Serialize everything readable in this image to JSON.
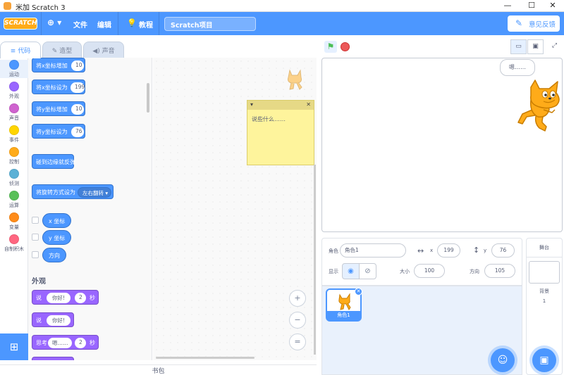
{
  "window": {
    "title": "米加 Scratch 3",
    "min": "—",
    "max": "☐",
    "close": "✕"
  },
  "menu": {
    "logo": "SCRATCH",
    "globe": "⊕ ▾",
    "file": "文件",
    "edit": "编辑",
    "tutorials": "教程",
    "project_title": "Scratch项目",
    "feedback": "意见反馈"
  },
  "tabs": {
    "code": "代码",
    "costumes": "造型",
    "sounds": "声音"
  },
  "categories": [
    {
      "label": "运动",
      "color": "#4c97ff"
    },
    {
      "label": "外观",
      "color": "#9966ff"
    },
    {
      "label": "声音",
      "color": "#cf63cf"
    },
    {
      "label": "事件",
      "color": "#ffd500"
    },
    {
      "label": "控制",
      "color": "#ffab19"
    },
    {
      "label": "侦测",
      "color": "#5cb1d6"
    },
    {
      "label": "运算",
      "color": "#59c059"
    },
    {
      "label": "变量",
      "color": "#ff8c1a"
    },
    {
      "label": "自制积木",
      "color": "#ff6680"
    }
  ],
  "blocks": {
    "change_x": "将x坐标增加",
    "change_x_val": "10",
    "set_x": "将x坐标设为",
    "set_x_val": "199",
    "change_y": "将y坐标增加",
    "change_y_val": "10",
    "set_y": "将y坐标设为",
    "set_y_val": "76",
    "bounce": "碰到边缘就反弹",
    "rotation": "将旋转方式设为",
    "rotation_val": "左右翻转 ▾",
    "x_pos": "x 坐标",
    "y_pos": "y 坐标",
    "direction": "方向",
    "looks_header": "外观",
    "say_secs": "说",
    "say_secs_text": "你好!",
    "say_secs_num": "2",
    "say_secs_unit": "秒",
    "say": "说",
    "say_text": "你好!",
    "think_secs": "思考",
    "think_text": "嗯……",
    "think_num": "2",
    "think_unit": "秒"
  },
  "note": {
    "collapse": "▾",
    "close": "✕",
    "text": "说些什么……"
  },
  "zoom": {
    "in": "+",
    "out": "−",
    "reset": "="
  },
  "backpack": "书包",
  "stage": {
    "bubble": "嗯……"
  },
  "sprite_info": {
    "sprite_label": "角色",
    "sprite_name": "角色1",
    "x_label": "x",
    "x_val": "199",
    "y_label": "y",
    "y_val": "76",
    "show_label": "显示",
    "size_label": "大小",
    "size_val": "100",
    "direction_label": "方向",
    "direction_val": "105"
  },
  "sprite_thumb": {
    "name": "角色1"
  },
  "stage_panel": {
    "header": "舞台",
    "backdrops_label": "背景",
    "backdrops_count": "1"
  }
}
